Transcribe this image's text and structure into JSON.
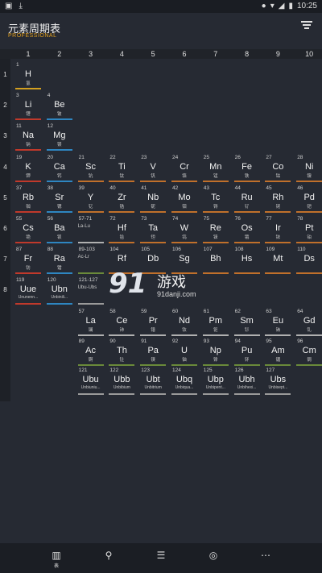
{
  "status": {
    "time": "10:25"
  },
  "app": {
    "title": "元素周期表",
    "subtitle": "PROFESSIONAL"
  },
  "columns": [
    "1",
    "2",
    "3",
    "4",
    "5",
    "6",
    "7",
    "8",
    "9",
    "10"
  ],
  "rows": [
    "1",
    "2",
    "3",
    "4",
    "5",
    "6",
    "7",
    "8"
  ],
  "colors": {
    "alkali": "#c0392b",
    "alkaline": "#2e86c1",
    "transition": "#c0702b",
    "nonmetal": "#d4a020",
    "lanthanide": "#b0b0b0",
    "actinide": "#6a8a3a",
    "unknown": "#9a9a9a"
  },
  "elements": [
    {
      "n": "1",
      "s": "H",
      "c": "氢",
      "col": 1,
      "row": 1,
      "cat": "nonmetal"
    },
    {
      "n": "3",
      "s": "Li",
      "c": "锂",
      "col": 1,
      "row": 2,
      "cat": "alkali"
    },
    {
      "n": "4",
      "s": "Be",
      "c": "铍",
      "col": 2,
      "row": 2,
      "cat": "alkaline"
    },
    {
      "n": "11",
      "s": "Na",
      "c": "钠",
      "col": 1,
      "row": 3,
      "cat": "alkali"
    },
    {
      "n": "12",
      "s": "Mg",
      "c": "镁",
      "col": 2,
      "row": 3,
      "cat": "alkaline"
    },
    {
      "n": "19",
      "s": "K",
      "c": "钾",
      "col": 1,
      "row": 4,
      "cat": "alkali"
    },
    {
      "n": "20",
      "s": "Ca",
      "c": "钙",
      "col": 2,
      "row": 4,
      "cat": "alkaline"
    },
    {
      "n": "21",
      "s": "Sc",
      "c": "钪",
      "col": 3,
      "row": 4,
      "cat": "transition"
    },
    {
      "n": "22",
      "s": "Ti",
      "c": "钛",
      "col": 4,
      "row": 4,
      "cat": "transition"
    },
    {
      "n": "23",
      "s": "V",
      "c": "钒",
      "col": 5,
      "row": 4,
      "cat": "transition"
    },
    {
      "n": "24",
      "s": "Cr",
      "c": "铬",
      "col": 6,
      "row": 4,
      "cat": "transition"
    },
    {
      "n": "25",
      "s": "Mn",
      "c": "锰",
      "col": 7,
      "row": 4,
      "cat": "transition"
    },
    {
      "n": "26",
      "s": "Fe",
      "c": "铁",
      "col": 8,
      "row": 4,
      "cat": "transition"
    },
    {
      "n": "27",
      "s": "Co",
      "c": "钴",
      "col": 9,
      "row": 4,
      "cat": "transition"
    },
    {
      "n": "28",
      "s": "Ni",
      "c": "镍",
      "col": 10,
      "row": 4,
      "cat": "transition"
    },
    {
      "n": "37",
      "s": "Rb",
      "c": "铷",
      "col": 1,
      "row": 5,
      "cat": "alkali"
    },
    {
      "n": "38",
      "s": "Sr",
      "c": "锶",
      "col": 2,
      "row": 5,
      "cat": "alkaline"
    },
    {
      "n": "39",
      "s": "Y",
      "c": "钇",
      "col": 3,
      "row": 5,
      "cat": "transition"
    },
    {
      "n": "40",
      "s": "Zr",
      "c": "锆",
      "col": 4,
      "row": 5,
      "cat": "transition"
    },
    {
      "n": "41",
      "s": "Nb",
      "c": "铌",
      "col": 5,
      "row": 5,
      "cat": "transition"
    },
    {
      "n": "42",
      "s": "Mo",
      "c": "钼",
      "col": 6,
      "row": 5,
      "cat": "transition"
    },
    {
      "n": "43",
      "s": "Tc",
      "c": "锝",
      "col": 7,
      "row": 5,
      "cat": "transition"
    },
    {
      "n": "44",
      "s": "Ru",
      "c": "钌",
      "col": 8,
      "row": 5,
      "cat": "transition"
    },
    {
      "n": "45",
      "s": "Rh",
      "c": "铑",
      "col": 9,
      "row": 5,
      "cat": "transition"
    },
    {
      "n": "46",
      "s": "Pd",
      "c": "钯",
      "col": 10,
      "row": 5,
      "cat": "transition"
    },
    {
      "n": "55",
      "s": "Cs",
      "c": "铯",
      "col": 1,
      "row": 6,
      "cat": "alkali"
    },
    {
      "n": "56",
      "s": "Ba",
      "c": "钡",
      "col": 2,
      "row": 6,
      "cat": "alkaline"
    },
    {
      "n": "57-71",
      "s": "La-Lu",
      "c": "",
      "col": 3,
      "row": 6,
      "cat": "lanthanide",
      "ref": true
    },
    {
      "n": "72",
      "s": "Hf",
      "c": "铪",
      "col": 4,
      "row": 6,
      "cat": "transition"
    },
    {
      "n": "73",
      "s": "Ta",
      "c": "钽",
      "col": 5,
      "row": 6,
      "cat": "transition"
    },
    {
      "n": "74",
      "s": "W",
      "c": "钨",
      "col": 6,
      "row": 6,
      "cat": "transition"
    },
    {
      "n": "75",
      "s": "Re",
      "c": "铼",
      "col": 7,
      "row": 6,
      "cat": "transition"
    },
    {
      "n": "76",
      "s": "Os",
      "c": "锇",
      "col": 8,
      "row": 6,
      "cat": "transition"
    },
    {
      "n": "77",
      "s": "Ir",
      "c": "铱",
      "col": 9,
      "row": 6,
      "cat": "transition"
    },
    {
      "n": "78",
      "s": "Pt",
      "c": "铂",
      "col": 10,
      "row": 6,
      "cat": "transition"
    },
    {
      "n": "87",
      "s": "Fr",
      "c": "钫",
      "col": 1,
      "row": 7,
      "cat": "alkali"
    },
    {
      "n": "88",
      "s": "Ra",
      "c": "镭",
      "col": 2,
      "row": 7,
      "cat": "alkaline"
    },
    {
      "n": "89-103",
      "s": "Ac-Lr",
      "c": "",
      "col": 3,
      "row": 7,
      "cat": "actinide",
      "ref": true
    },
    {
      "n": "104",
      "s": "Rf",
      "c": "",
      "col": 4,
      "row": 7,
      "cat": "transition"
    },
    {
      "n": "105",
      "s": "Db",
      "c": "",
      "col": 5,
      "row": 7,
      "cat": "transition"
    },
    {
      "n": "106",
      "s": "Sg",
      "c": "",
      "col": 6,
      "row": 7,
      "cat": "transition"
    },
    {
      "n": "107",
      "s": "Bh",
      "c": "",
      "col": 7,
      "row": 7,
      "cat": "transition"
    },
    {
      "n": "108",
      "s": "Hs",
      "c": "",
      "col": 8,
      "row": 7,
      "cat": "transition"
    },
    {
      "n": "109",
      "s": "Mt",
      "c": "",
      "col": 9,
      "row": 7,
      "cat": "transition"
    },
    {
      "n": "110",
      "s": "Ds",
      "c": "",
      "col": 10,
      "row": 7,
      "cat": "transition"
    },
    {
      "n": "119",
      "s": "Uue",
      "c": "Ununenn...",
      "col": 1,
      "row": 8,
      "cat": "alkali",
      "long": true
    },
    {
      "n": "120",
      "s": "Ubn",
      "c": "Unbinili...",
      "col": 2,
      "row": 8,
      "cat": "alkaline",
      "long": true
    },
    {
      "n": "121-127",
      "s": "Ubu-Ubs",
      "c": "",
      "col": 3,
      "row": 8,
      "cat": "unknown",
      "ref": true
    },
    {
      "n": "57",
      "s": "La",
      "c": "镧",
      "col": 3,
      "row": 10,
      "cat": "lanthanide"
    },
    {
      "n": "58",
      "s": "Ce",
      "c": "铈",
      "col": 4,
      "row": 10,
      "cat": "lanthanide"
    },
    {
      "n": "59",
      "s": "Pr",
      "c": "镨",
      "col": 5,
      "row": 10,
      "cat": "lanthanide"
    },
    {
      "n": "60",
      "s": "Nd",
      "c": "钕",
      "col": 6,
      "row": 10,
      "cat": "lanthanide"
    },
    {
      "n": "61",
      "s": "Pm",
      "c": "钷",
      "col": 7,
      "row": 10,
      "cat": "lanthanide"
    },
    {
      "n": "62",
      "s": "Sm",
      "c": "钐",
      "col": 8,
      "row": 10,
      "cat": "lanthanide"
    },
    {
      "n": "63",
      "s": "Eu",
      "c": "铕",
      "col": 9,
      "row": 10,
      "cat": "lanthanide"
    },
    {
      "n": "64",
      "s": "Gd",
      "c": "钆",
      "col": 10,
      "row": 10,
      "cat": "lanthanide"
    },
    {
      "n": "89",
      "s": "Ac",
      "c": "锕",
      "col": 3,
      "row": 11,
      "cat": "actinide"
    },
    {
      "n": "90",
      "s": "Th",
      "c": "钍",
      "col": 4,
      "row": 11,
      "cat": "actinide"
    },
    {
      "n": "91",
      "s": "Pa",
      "c": "镤",
      "col": 5,
      "row": 11,
      "cat": "actinide"
    },
    {
      "n": "92",
      "s": "U",
      "c": "铀",
      "col": 6,
      "row": 11,
      "cat": "actinide"
    },
    {
      "n": "93",
      "s": "Np",
      "c": "镎",
      "col": 7,
      "row": 11,
      "cat": "actinide"
    },
    {
      "n": "94",
      "s": "Pu",
      "c": "钚",
      "col": 8,
      "row": 11,
      "cat": "actinide"
    },
    {
      "n": "95",
      "s": "Am",
      "c": "镅",
      "col": 9,
      "row": 11,
      "cat": "actinide"
    },
    {
      "n": "96",
      "s": "Cm",
      "c": "锔",
      "col": 10,
      "row": 11,
      "cat": "actinide"
    },
    {
      "n": "121",
      "s": "Ubu",
      "c": "Unbiuniu...",
      "col": 3,
      "row": 12,
      "cat": "unknown",
      "long": true
    },
    {
      "n": "122",
      "s": "Ubb",
      "c": "Unbibium",
      "col": 4,
      "row": 12,
      "cat": "unknown",
      "long": true
    },
    {
      "n": "123",
      "s": "Ubt",
      "c": "Unbitrium",
      "col": 5,
      "row": 12,
      "cat": "unknown",
      "long": true
    },
    {
      "n": "124",
      "s": "Ubq",
      "c": "Unbiqua...",
      "col": 6,
      "row": 12,
      "cat": "unknown",
      "long": true
    },
    {
      "n": "125",
      "s": "Ubp",
      "c": "Unbipent...",
      "col": 7,
      "row": 12,
      "cat": "unknown",
      "long": true
    },
    {
      "n": "126",
      "s": "Ubh",
      "c": "Unbihexi...",
      "col": 8,
      "row": 12,
      "cat": "unknown",
      "long": true
    },
    {
      "n": "127",
      "s": "Ubs",
      "c": "Unbisept...",
      "col": 9,
      "row": 12,
      "cat": "unknown",
      "long": true
    }
  ],
  "watermark": {
    "logo": "91",
    "text": "游戏",
    "domain": "91danji.com"
  },
  "nav": [
    {
      "icon": "table-icon",
      "label": "表"
    },
    {
      "icon": "search-icon",
      "label": ""
    },
    {
      "icon": "list-icon",
      "label": ""
    },
    {
      "icon": "atom-icon",
      "label": ""
    },
    {
      "icon": "more-icon",
      "label": ""
    }
  ]
}
